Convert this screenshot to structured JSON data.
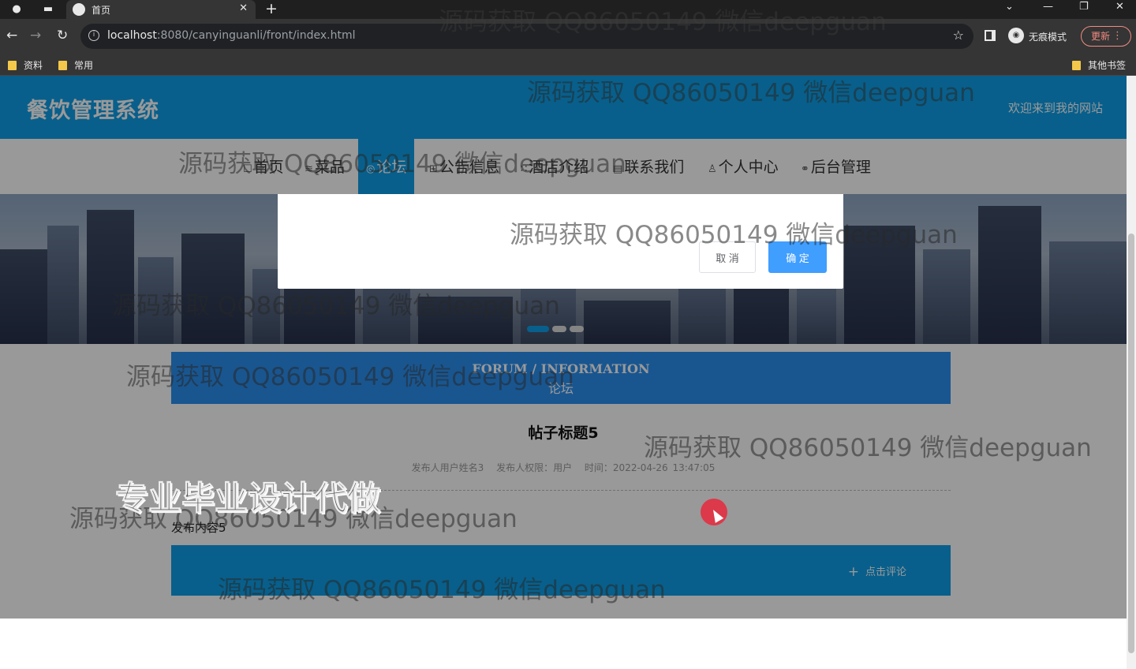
{
  "browser": {
    "tab_title": "首页",
    "url_host": "localhost",
    "url_path": ":8080/canyinguanli/front/index.html",
    "incognito_label": "无痕模式",
    "update_label": "更新",
    "bookmarks": [
      "资料",
      "常用"
    ],
    "other_bookmarks": "其他书签"
  },
  "site": {
    "title": "餐饮管理系统",
    "welcome": "欢迎来到我的网站"
  },
  "nav": {
    "items": [
      {
        "icon": "☐",
        "label": "首页"
      },
      {
        "icon": "≋",
        "label": "菜品"
      },
      {
        "icon": "◎",
        "label": "论坛"
      },
      {
        "icon": "⊞",
        "label": "公告信息"
      },
      {
        "icon": "∷",
        "label": "酒店介绍"
      },
      {
        "icon": "▤",
        "label": "联系我们"
      },
      {
        "icon": "♙",
        "label": "个人中心"
      },
      {
        "icon": "⚭",
        "label": "后台管理"
      }
    ],
    "active_index": 2
  },
  "dialog": {
    "cancel_label": "取 消",
    "confirm_label": "确 定"
  },
  "forum": {
    "heading_en": "FORUM / INFORMATION",
    "heading_cn": "论坛"
  },
  "post": {
    "title": "帖子标题5",
    "author": "发布人用户姓名3",
    "role": "发布人权限：用户",
    "time": "时间：2022-04-26 13:47:05",
    "content": "发布内容5",
    "comment_label": "点击评论"
  },
  "watermarks": {
    "text": "源码获取 QQ86050149 微信deepguan",
    "promo": "专业毕业设计代做"
  },
  "colors": {
    "brand": "#0e9ee8",
    "primary_button": "#409eff",
    "forum_heading": "#2b8ff0"
  }
}
